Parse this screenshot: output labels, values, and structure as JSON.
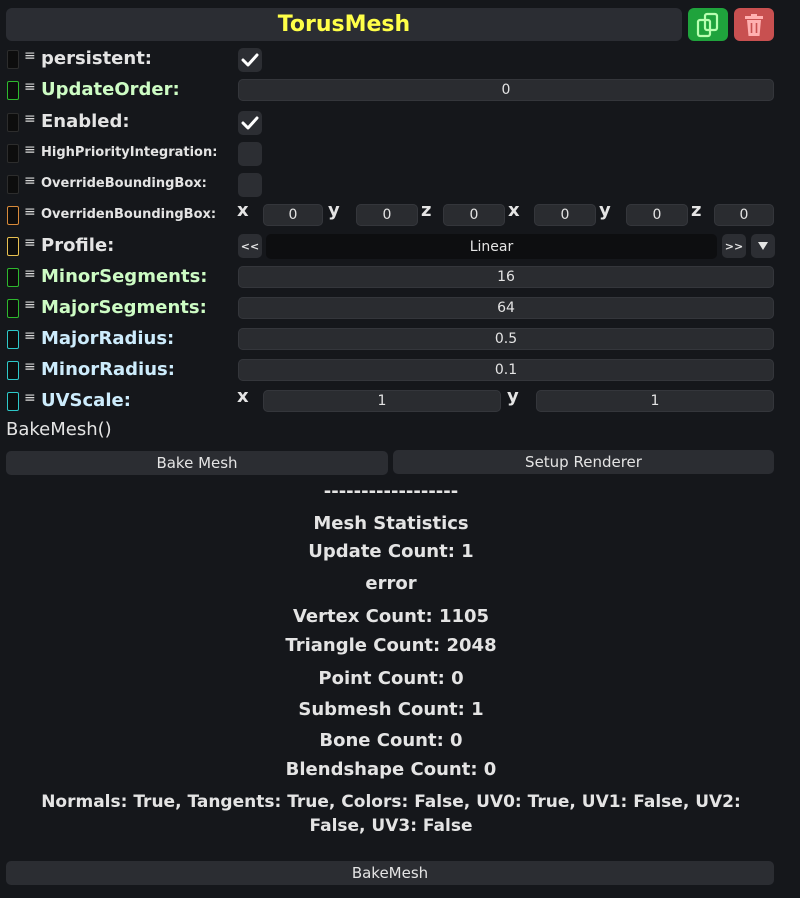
{
  "header": {
    "title": "TorusMesh"
  },
  "icons": {
    "copy": "copy-icon",
    "delete": "trash-icon"
  },
  "colors": {
    "title": "#ffff48",
    "copy_button": "#1fa33c",
    "delete_button": "#c85050",
    "label_green": "#cdfcc4",
    "label_cyan": "#cdecfc"
  },
  "fields": {
    "persistent": {
      "label": "persistent:",
      "checked": true
    },
    "update_order": {
      "label": "UpdateOrder:",
      "value": "0"
    },
    "enabled": {
      "label": "Enabled:",
      "checked": true
    },
    "high_priority": {
      "label": "HighPriorityIntegration:",
      "checked": false
    },
    "override_bbox": {
      "label": "OverrideBoundingBox:",
      "checked": false
    },
    "overriden_bbox": {
      "label": "OverridenBoundingBox:",
      "axes": [
        "x",
        "y",
        "z",
        "x",
        "y",
        "z"
      ],
      "values": [
        "0",
        "0",
        "0",
        "0",
        "0",
        "0"
      ]
    },
    "profile": {
      "label": "Profile:",
      "value": "Linear",
      "prev": "<<",
      "next": ">>"
    },
    "minor_segments": {
      "label": "MinorSegments:",
      "value": "16"
    },
    "major_segments": {
      "label": "MajorSegments:",
      "value": "64"
    },
    "major_radius": {
      "label": "MajorRadius:",
      "value": "0.5"
    },
    "minor_radius": {
      "label": "MinorRadius:",
      "value": "0.1"
    },
    "uv_scale": {
      "label": "UVScale:",
      "axes": [
        "x",
        "y"
      ],
      "values": [
        "1",
        "1"
      ]
    }
  },
  "method": {
    "name": "BakeMesh()"
  },
  "buttons": {
    "bake_mesh": "Bake Mesh",
    "setup_renderer": "Setup Renderer",
    "bake_mesh_bottom": "BakeMesh"
  },
  "stats": {
    "divider": "------------------",
    "title": "Mesh Statistics",
    "update_count": "Update Count: 1",
    "error": "error",
    "vertex_count": "Vertex Count: 1105",
    "triangle_count": "Triangle Count: 2048",
    "point_count": "Point Count: 0",
    "submesh_count": "Submesh Count: 1",
    "bone_count": "Bone Count: 0",
    "blendshape_count": "Blendshape Count: 0",
    "flags_line1": "Normals: True, Tangents: True, Colors: False, UV0: True, UV1: False, UV2:",
    "flags_line2": "False, UV3: False"
  }
}
